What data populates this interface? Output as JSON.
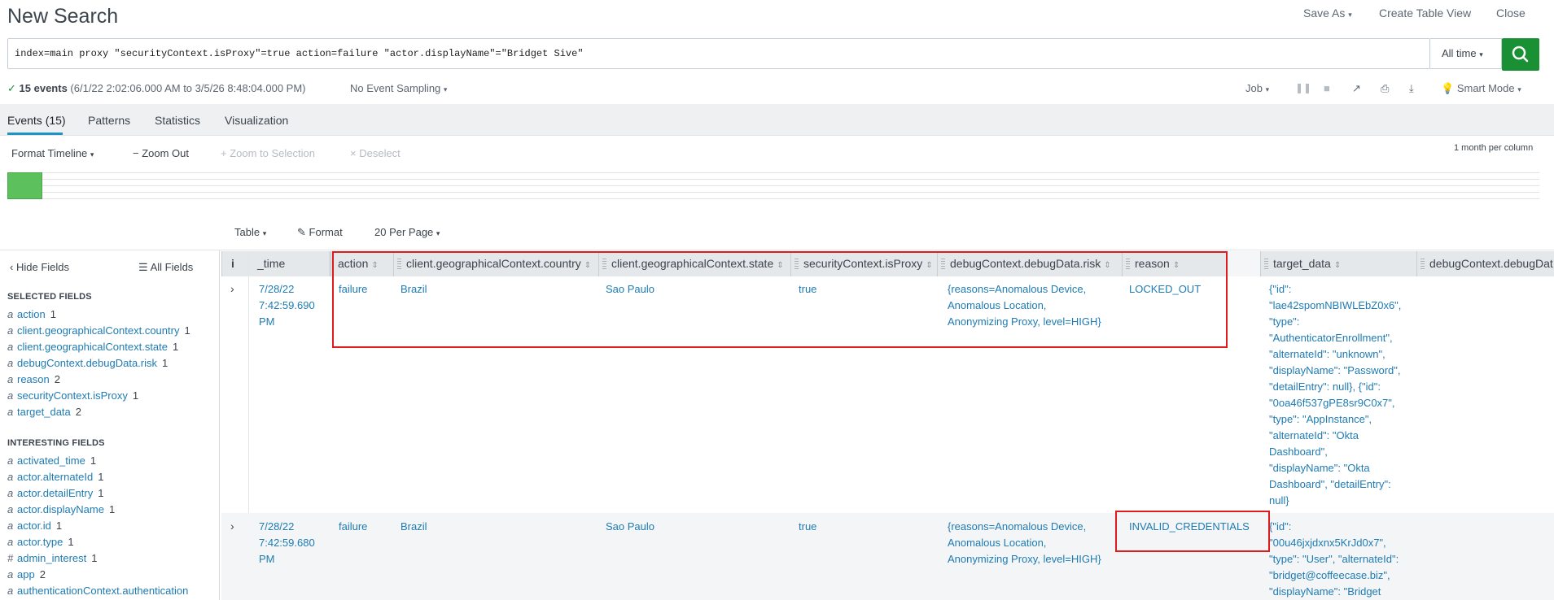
{
  "header": {
    "title": "New Search",
    "save_as": "Save As",
    "create_table_view": "Create Table View",
    "close": "Close"
  },
  "search": {
    "query": "index=main proxy \"securityContext.isProxy\"=true action=failure \"actor.displayName\"=\"Bridget Sive\"",
    "time_range": "All time"
  },
  "status": {
    "count": "15 events",
    "range": "(6/1/22 2:02:06.000 AM to 3/5/26 8:48:04.000 PM)",
    "sampling": "No Event Sampling",
    "job": "Job",
    "mode": "Smart Mode"
  },
  "tabs": [
    {
      "label": "Events (15)"
    },
    {
      "label": "Patterns"
    },
    {
      "label": "Statistics"
    },
    {
      "label": "Visualization"
    }
  ],
  "timeline": {
    "format": "Format Timeline",
    "zoom_out": "Zoom Out",
    "zoom_selection": "Zoom to Selection",
    "deselect": "Deselect",
    "scale": "1 month per column"
  },
  "table_controls": {
    "table": "Table",
    "format": "Format",
    "per_page": "20 Per Page"
  },
  "sidebar": {
    "hide_fields": "Hide Fields",
    "all_fields": "All Fields",
    "selected_heading": "SELECTED FIELDS",
    "selected": [
      {
        "type": "a",
        "name": "action",
        "count": "1"
      },
      {
        "type": "a",
        "name": "client.geographicalContext.country",
        "count": "1"
      },
      {
        "type": "a",
        "name": "client.geographicalContext.state",
        "count": "1"
      },
      {
        "type": "a",
        "name": "debugContext.debugData.risk",
        "count": "1"
      },
      {
        "type": "a",
        "name": "reason",
        "count": "2"
      },
      {
        "type": "a",
        "name": "securityContext.isProxy",
        "count": "1"
      },
      {
        "type": "a",
        "name": "target_data",
        "count": "2"
      }
    ],
    "interesting_heading": "INTERESTING FIELDS",
    "interesting": [
      {
        "type": "a",
        "name": "activated_time",
        "count": "1"
      },
      {
        "type": "a",
        "name": "actor.alternateId",
        "count": "1"
      },
      {
        "type": "a",
        "name": "actor.detailEntry",
        "count": "1"
      },
      {
        "type": "a",
        "name": "actor.displayName",
        "count": "1"
      },
      {
        "type": "a",
        "name": "actor.id",
        "count": "1"
      },
      {
        "type": "a",
        "name": "actor.type",
        "count": "1"
      },
      {
        "type": "#",
        "name": "admin_interest",
        "count": "1"
      },
      {
        "type": "a",
        "name": "app",
        "count": "2"
      },
      {
        "type": "a",
        "name": "authenticationContext.authentication",
        "count": ""
      }
    ]
  },
  "table": {
    "columns": {
      "info": "i",
      "time": "_time",
      "action": "action",
      "country": "client.geographicalContext.country",
      "state": "client.geographicalContext.state",
      "proxy": "securityContext.isProxy",
      "risk": "debugContext.debugData.risk",
      "reason": "reason",
      "target": "target_data",
      "debug": "debugContext.debugDat"
    },
    "rows": [
      {
        "time": [
          "7/28/22",
          "7:42:59.690",
          "PM"
        ],
        "action": "failure",
        "country": "Brazil",
        "state": "Sao Paulo",
        "proxy": "true",
        "risk": [
          "{reasons=Anomalous Device,",
          "Anomalous Location,",
          "Anonymizing Proxy, level=HIGH}"
        ],
        "reason": "LOCKED_OUT",
        "target": [
          "{\"id\":",
          "\"lae42spomNBIWLEbZ0x6\",",
          "\"type\":",
          "\"AuthenticatorEnrollment\",",
          "\"alternateId\": \"unknown\",",
          "\"displayName\": \"Password\",",
          "\"detailEntry\": null}, {\"id\":",
          "\"0oa46f537gPE8sr9C0x7\",",
          "\"type\": \"AppInstance\",",
          "\"alternateId\": \"Okta",
          "Dashboard\",",
          "\"displayName\": \"Okta",
          "Dashboard\", \"detailEntry\":",
          "null}"
        ]
      },
      {
        "time": [
          "7/28/22",
          "7:42:59.680",
          "PM"
        ],
        "action": "failure",
        "country": "Brazil",
        "state": "Sao Paulo",
        "proxy": "true",
        "risk": [
          "{reasons=Anomalous Device,",
          "Anomalous Location,",
          "Anonymizing Proxy, level=HIGH}"
        ],
        "reason": "INVALID_CREDENTIALS",
        "target": [
          "{\"id\":",
          "\"00u46jxjdxnx5KrJd0x7\",",
          "\"type\": \"User\", \"alternateId\":",
          "\"bridget@coffeecase.biz\",",
          "\"displayName\": \"Bridget"
        ]
      }
    ]
  },
  "colors": {
    "accent": "#1e93c6",
    "link": "#1e7bb3",
    "search_button": "#1a9035",
    "highlight": "#e01b1b",
    "timeline_bar": "#5cc05c"
  }
}
